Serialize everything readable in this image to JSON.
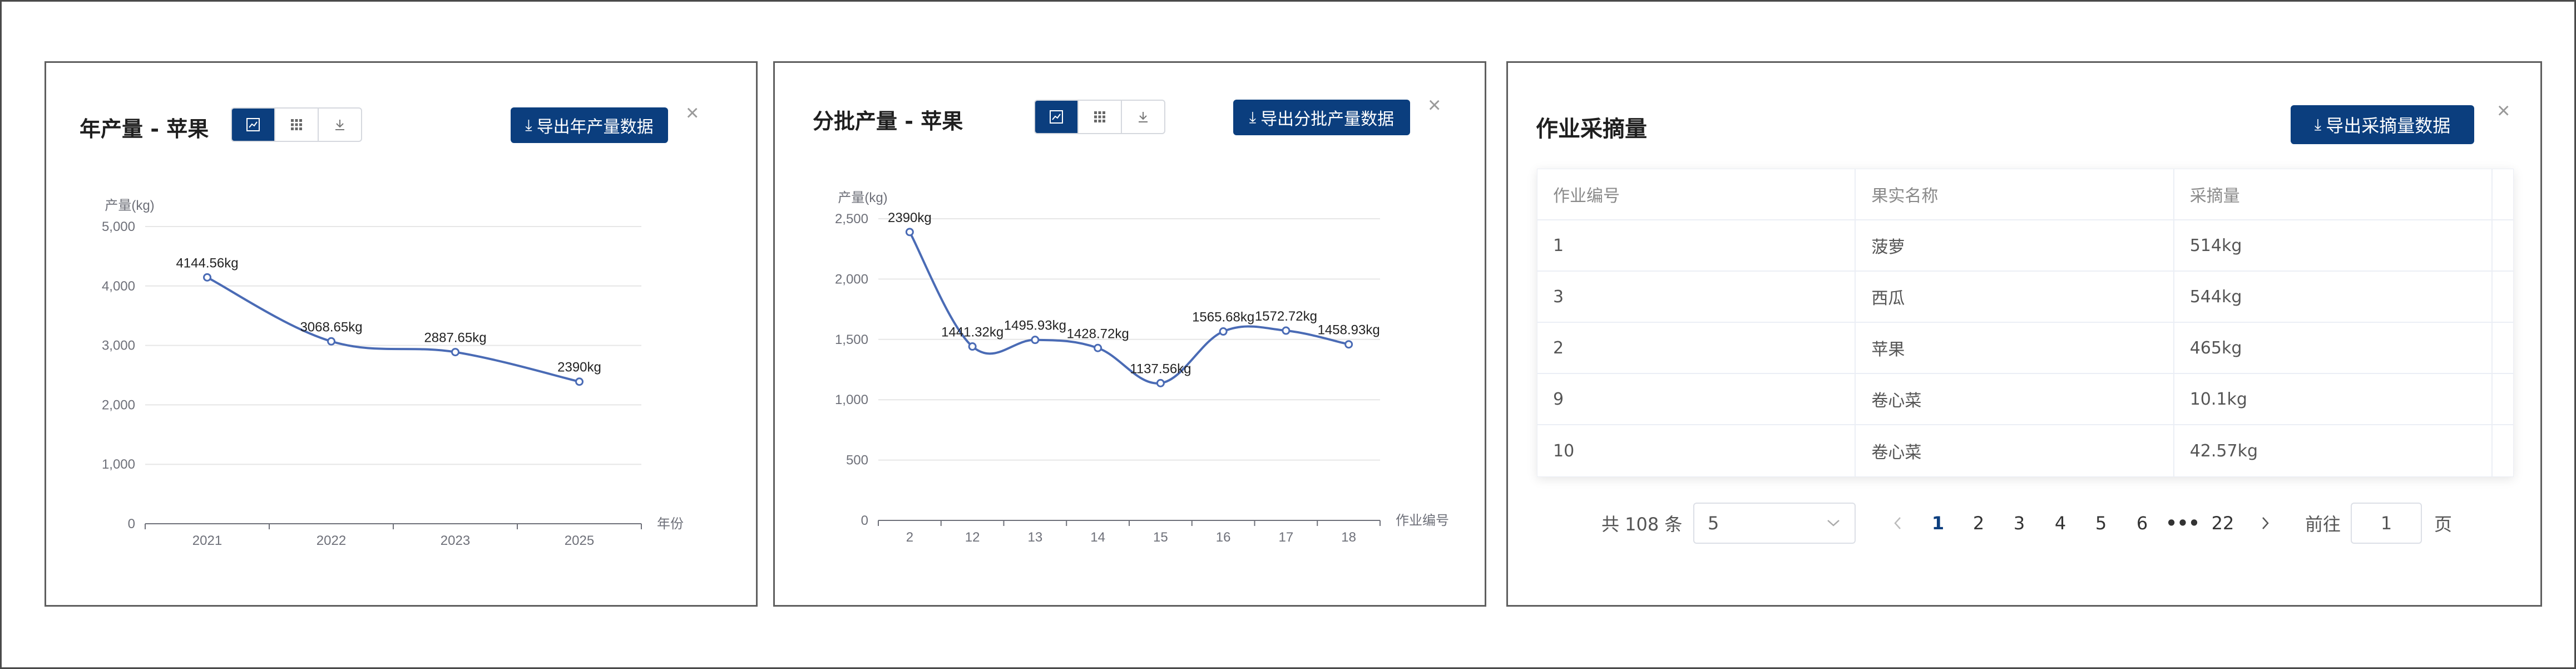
{
  "panels": {
    "annual": {
      "title": "年产量 - 苹果",
      "export_label": "导出年产量数据",
      "close": "×"
    },
    "batch": {
      "title": "分批产量 - 苹果",
      "export_label": "导出分批产量数据",
      "close": "×"
    },
    "harvest": {
      "title": "作业采摘量",
      "export_label": "导出采摘量数据",
      "close": "×",
      "columns": [
        "作业编号",
        "果实名称",
        "采摘量"
      ],
      "rows": [
        [
          "1",
          "菠萝",
          "514kg"
        ],
        [
          "3",
          "西瓜",
          "544kg"
        ],
        [
          "2",
          "苹果",
          "465kg"
        ],
        [
          "9",
          "卷心菜",
          "10.1kg"
        ],
        [
          "10",
          "卷心菜",
          "42.57kg"
        ]
      ],
      "pagination": {
        "total": "共 108 条",
        "page_size": "5",
        "pages": [
          "1",
          "2",
          "3",
          "4",
          "5",
          "6",
          "•••",
          "22"
        ],
        "current": "1",
        "goto_prefix": "前往",
        "goto_value": "1",
        "goto_suffix": "页"
      }
    }
  },
  "icons": {
    "line_chart": "line-chart-icon",
    "table": "grid-icon",
    "download": "download-icon",
    "close": "close-icon"
  },
  "colors": {
    "primary": "#0b3e7e",
    "line": "#4a6bb5",
    "grid": "#e6e6e6"
  },
  "chart_data": [
    {
      "type": "line",
      "smooth": true,
      "categories": [
        "2021",
        "2022",
        "2023",
        "2025"
      ],
      "values": [
        4144.56,
        3068.65,
        2887.65,
        2390
      ],
      "data_labels": [
        "4144.56kg",
        "3068.65kg",
        "2887.65kg",
        "2390kg"
      ],
      "ylabel": "产量(kg)",
      "xlabel": "年份",
      "ylim": [
        0,
        5000
      ],
      "yticks": [
        "0",
        "1,000",
        "2,000",
        "3,000",
        "4,000",
        "5,000"
      ],
      "grid": true
    },
    {
      "type": "line",
      "smooth": true,
      "categories": [
        "2",
        "12",
        "13",
        "14",
        "15",
        "16",
        "17",
        "18"
      ],
      "values": [
        2390,
        1441.32,
        1495.93,
        1428.72,
        1137.56,
        1565.68,
        1572.72,
        1458.93
      ],
      "data_labels": [
        "2390kg",
        "1441.32kg",
        "1495.93kg",
        "1428.72kg",
        "1137.56kg",
        "1565.68kg",
        "1572.72kg",
        "1458.93kg"
      ],
      "ylabel": "产量(kg)",
      "xlabel": "作业编号",
      "ylim": [
        0,
        2500
      ],
      "yticks": [
        "0",
        "500",
        "1,000",
        "1,500",
        "2,000",
        "2,500"
      ],
      "grid": true
    }
  ]
}
